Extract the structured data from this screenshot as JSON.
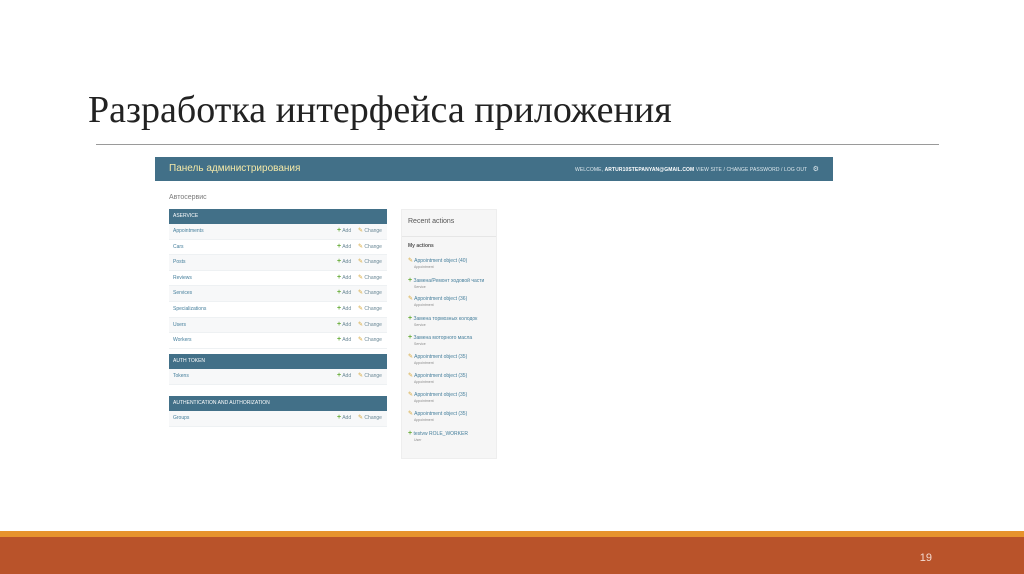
{
  "slide": {
    "title": "Разработка интерфейса приложения",
    "page_number": "19",
    "colors": {
      "stripe": "#e7932d",
      "footer": "#b9532a",
      "admin_header": "#427088"
    }
  },
  "admin": {
    "brand": "Панель администрирования",
    "usertools": {
      "welcome": "WELCOME,",
      "user": "ARTUR10STEPANYAN@GMAIL.COM",
      "links": "VIEW SITE / CHANGE PASSWORD / LOG OUT"
    },
    "breadcrumb": "Автосервис",
    "add_label": "Add",
    "change_label": "Change",
    "modules": [
      {
        "caption": "ASERVICE",
        "rows": [
          "Appointments",
          "Cars",
          "Posts",
          "Reviews",
          "Services",
          "Specializations",
          "Users",
          "Workers"
        ]
      },
      {
        "caption": "AUTH TOKEN",
        "rows": [
          "Tokens"
        ]
      },
      {
        "caption": "AUTHENTICATION AND AUTHORIZATION",
        "rows": [
          "Groups"
        ]
      }
    ],
    "recent": {
      "title": "Recent actions",
      "subtitle": "My actions",
      "items": [
        {
          "icon": "pencil-icon",
          "text": "Appointment object (40)",
          "type": "Appointment"
        },
        {
          "icon": "plus-icon",
          "text": "Замена/Ремонт ходовой части",
          "type": "Service"
        },
        {
          "icon": "pencil-icon",
          "text": "Appointment object (36)",
          "type": "Appointment"
        },
        {
          "icon": "plus-icon",
          "text": "Замена тормозных колодок",
          "type": "Service"
        },
        {
          "icon": "plus-icon",
          "text": "Замена моторного масла",
          "type": "Service"
        },
        {
          "icon": "pencil-icon",
          "text": "Appointment object (35)",
          "type": "Appointment"
        },
        {
          "icon": "pencil-icon",
          "text": "Appointment object (35)",
          "type": "Appointment"
        },
        {
          "icon": "pencil-icon",
          "text": "Appointment object (35)",
          "type": "Appointment"
        },
        {
          "icon": "pencil-icon",
          "text": "Appointment object (35)",
          "type": "Appointment"
        },
        {
          "icon": "plus-icon",
          "text": "testvw ROLE_WORKER",
          "type": "User"
        }
      ]
    }
  }
}
